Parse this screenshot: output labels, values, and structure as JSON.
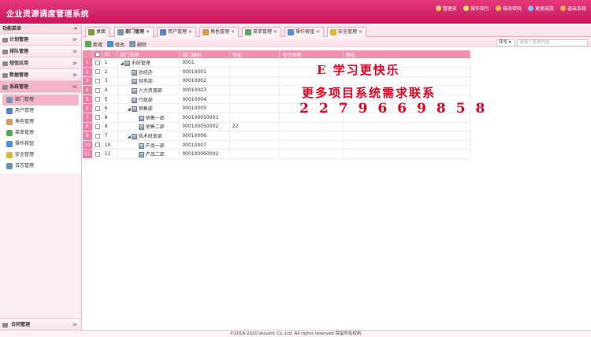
{
  "header": {
    "title": "企业资源调度管理系统",
    "links": [
      {
        "label": "管理员",
        "icon": "user-icon",
        "color": "#ffd36b"
      },
      {
        "label": "操作指引",
        "icon": "bulb-icon",
        "color": "#ffe36b"
      },
      {
        "label": "修改密码",
        "icon": "key-icon",
        "color": "#f5c44a"
      },
      {
        "label": "更换皮肤",
        "icon": "skin-icon",
        "color": "#7ec3ff"
      },
      {
        "label": "退出系统",
        "icon": "exit-icon",
        "color": "#ffb347"
      }
    ]
  },
  "sidebar": {
    "title": "功能菜单",
    "collapse": "«",
    "groups": [
      {
        "label": "计划管理",
        "chev": "≫"
      },
      {
        "label": "排队管理",
        "chev": "≫"
      },
      {
        "label": "短信应用",
        "chev": "≫"
      },
      {
        "label": "数据管理",
        "chev": "≫"
      },
      {
        "label": "系统管理",
        "chev": "≪"
      }
    ],
    "sub_items": [
      {
        "label": "部门管理",
        "color": "#7d95ad"
      },
      {
        "label": "用户管理",
        "color": "#5a7fcf"
      },
      {
        "label": "角色管理",
        "color": "#d59b54"
      },
      {
        "label": "菜单管理",
        "color": "#5aa75a"
      },
      {
        "label": "操作按钮",
        "color": "#4e8fd8"
      },
      {
        "label": "安全管理",
        "color": "#e0b43a"
      },
      {
        "label": "日志管理",
        "color": "#6b8fb8"
      }
    ],
    "bottom": {
      "label": "合同管理",
      "chev": "≫"
    }
  },
  "tabs": [
    {
      "label": "桌面",
      "color": "#7c9b3a"
    },
    {
      "label": "部门管理",
      "color": "#7d95ad"
    },
    {
      "label": "用户管理",
      "color": "#5a7fcf"
    },
    {
      "label": "角色管理",
      "color": "#d59b54"
    },
    {
      "label": "菜单管理",
      "color": "#5aa75a"
    },
    {
      "label": "操作按钮",
      "color": "#4e8fd8"
    },
    {
      "label": "安全管理",
      "color": "#e0b43a"
    }
  ],
  "tab_close": "×",
  "toolbar": {
    "add": "新增",
    "edit": "修改",
    "delete": "删除"
  },
  "search": {
    "field": "序号 ▾",
    "placeholder": "请输入查询内容"
  },
  "table": {
    "columns": [
      "ID",
      "部门名称",
      "部门编码",
      "地址",
      "电子邮箱",
      "网址"
    ],
    "rows": [
      {
        "n": "1",
        "id": "1",
        "name": "系统管理",
        "code": "0001",
        "addr": "",
        "level": 0,
        "arrow": "◢"
      },
      {
        "n": "2",
        "id": "2",
        "name": "总经办",
        "code": "00010001",
        "addr": "",
        "level": 1,
        "arrow": ""
      },
      {
        "n": "3",
        "id": "3",
        "name": "财务部",
        "code": "00010002",
        "addr": "",
        "level": 1,
        "arrow": ""
      },
      {
        "n": "4",
        "id": "4",
        "name": "人力资源部",
        "code": "00010003",
        "addr": "",
        "level": 1,
        "arrow": ""
      },
      {
        "n": "5",
        "id": "5",
        "name": "行政部",
        "code": "00010004",
        "addr": "",
        "level": 1,
        "arrow": ""
      },
      {
        "n": "6",
        "id": "6",
        "name": "销售部",
        "code": "00010005",
        "addr": "",
        "level": 1,
        "arrow": "◢"
      },
      {
        "n": "7",
        "id": "8",
        "name": "销售一部",
        "code": "000100050001",
        "addr": "",
        "level": 2,
        "arrow": ""
      },
      {
        "n": "8",
        "id": "9",
        "name": "销售二部",
        "code": "000100050002",
        "addr": "22",
        "level": 2,
        "arrow": ""
      },
      {
        "n": "9",
        "id": "7",
        "name": "技术研发部",
        "code": "00010006",
        "addr": "",
        "level": 1,
        "arrow": "◢"
      },
      {
        "n": "10",
        "id": "10",
        "name": "产品一部",
        "code": "00010007",
        "addr": "",
        "level": 2,
        "arrow": ""
      },
      {
        "n": "11",
        "id": "11",
        "name": "产品二部",
        "code": "000100060002",
        "addr": "",
        "level": 2,
        "arrow": ""
      }
    ]
  },
  "promo": {
    "line1": "E  学习更快乐",
    "line2": "更多项目系统需求联系",
    "line3": "2279669858"
  },
  "footer": "©2016-2020 wuyant Co.,Ltd. All rights reserved 保留所有权利"
}
